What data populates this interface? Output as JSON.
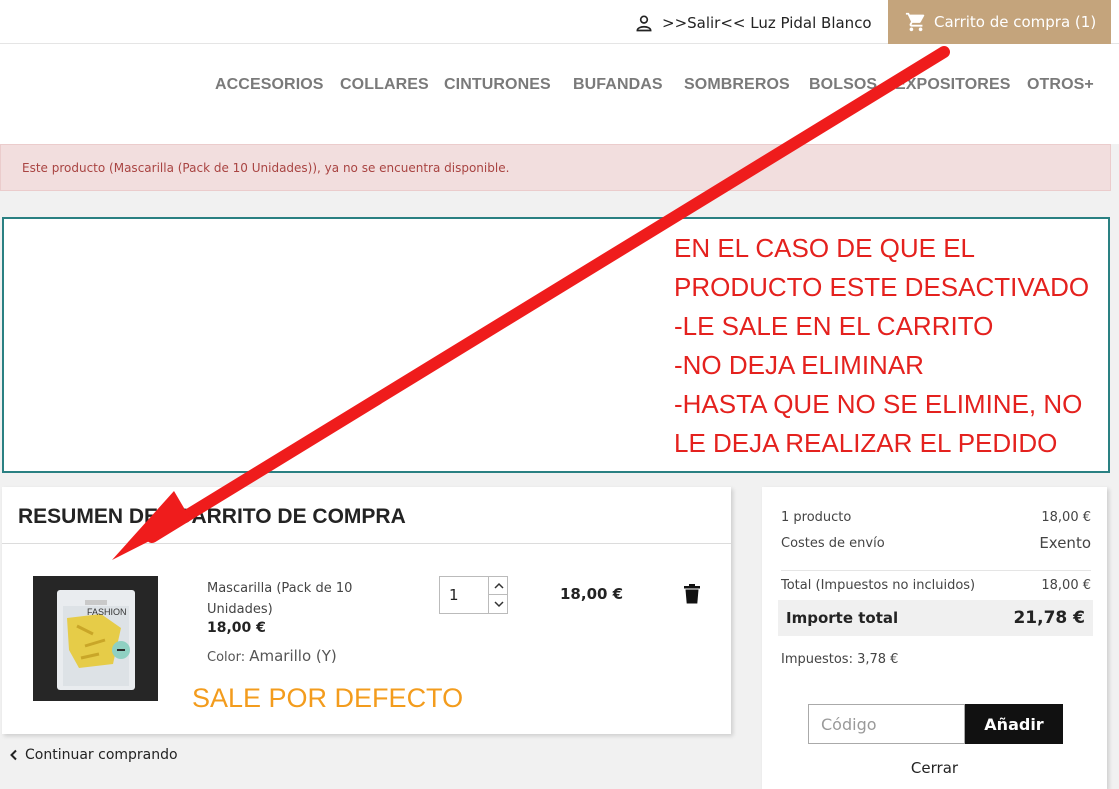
{
  "header": {
    "user_label": ">>Salir<< Luz Pidal Blanco",
    "user_icon": "user-icon",
    "cart_label": "Carrito de compra (1)",
    "cart_icon": "shopping-cart-icon",
    "cart_color": "#c4a47c"
  },
  "nav": {
    "items": [
      "ACCESORIOS",
      "COLLARES",
      "CINTURONES",
      "BUFANDAS",
      "SOMBREROS",
      "BOLSOS",
      "EXPOSITORES",
      "OTROS+"
    ]
  },
  "alert": {
    "message": "Este producto (Mascarilla (Pack de 10 Unidades)), ya no se encuentra disponible."
  },
  "annotation": {
    "lines": [
      "EN EL CASO DE QUE EL",
      "PRODUCTO ESTE DESACTIVADO",
      "-LE SALE EN EL CARRITO",
      "-NO DEJA ELIMINAR",
      "-HASTA QUE NO SE ELIMINE, NO",
      "LE DEJA REALIZAR EL PEDIDO"
    ],
    "default_note": "SALE POR DEFECTO",
    "annotation_color": "#e4211e",
    "default_note_color": "#f39c1d"
  },
  "cart": {
    "title": "RESUMEN DEL CARRITO DE COMPRA",
    "item": {
      "name": "Mascarilla (Pack de 10 Unidades)",
      "unit_price": "18,00 €",
      "color_label": "Color:",
      "color_value": "Amarillo (Y)",
      "quantity": "1",
      "line_total": "18,00 €",
      "image_text": "FASHION",
      "delete_icon": "trash-icon"
    },
    "continue_label": "Continuar comprando"
  },
  "totals": {
    "products_label": "1 producto",
    "products_value": "18,00 €",
    "shipping_label": "Costes de envío",
    "shipping_value": "Exento",
    "subtotal_label": "Total (Impuestos no incluidos)",
    "subtotal_value": "18,00 €",
    "grand_label": "Importe total",
    "grand_value": "21,78 €",
    "taxes_label": "Impuestos: 3,78 €",
    "promo_placeholder": "Código",
    "promo_button": "Añadir",
    "close_label": "Cerrar"
  }
}
